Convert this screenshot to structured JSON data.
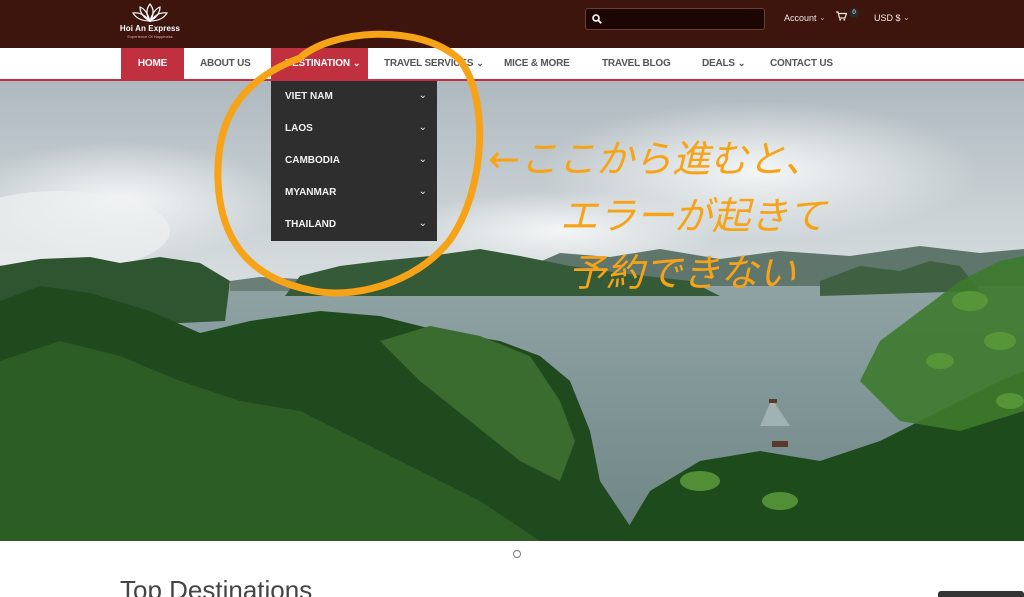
{
  "brand": {
    "name": "Hoi An Express",
    "tagline": "Experience Of Happiness"
  },
  "header": {
    "search_placeholder": "",
    "account_label": "Account",
    "cart_count": "0",
    "currency_label": "USD $"
  },
  "nav": {
    "items": [
      {
        "label": "HOME"
      },
      {
        "label": "ABOUT US"
      },
      {
        "label": "DESTINATION"
      },
      {
        "label": "TRAVEL SERVICES"
      },
      {
        "label": "MICE & MORE"
      },
      {
        "label": "TRAVEL BLOG"
      },
      {
        "label": "DEALS"
      },
      {
        "label": "CONTACT US"
      }
    ]
  },
  "dropdown": {
    "items": [
      {
        "label": "VIET NAM"
      },
      {
        "label": "LAOS"
      },
      {
        "label": "CAMBODIA"
      },
      {
        "label": "MYANMAR"
      },
      {
        "label": "THAILAND"
      }
    ]
  },
  "annotation": {
    "arrow": "←",
    "line1": "ここから進むと、",
    "line2": "エラーが起きて",
    "line3": "予約できない",
    "color": "#f7a317"
  },
  "main": {
    "section_title": "Top Destinations"
  },
  "colors": {
    "topbar": "#3d150d",
    "accent": "#c0303f",
    "dropdown_bg": "#2e2e2e"
  }
}
